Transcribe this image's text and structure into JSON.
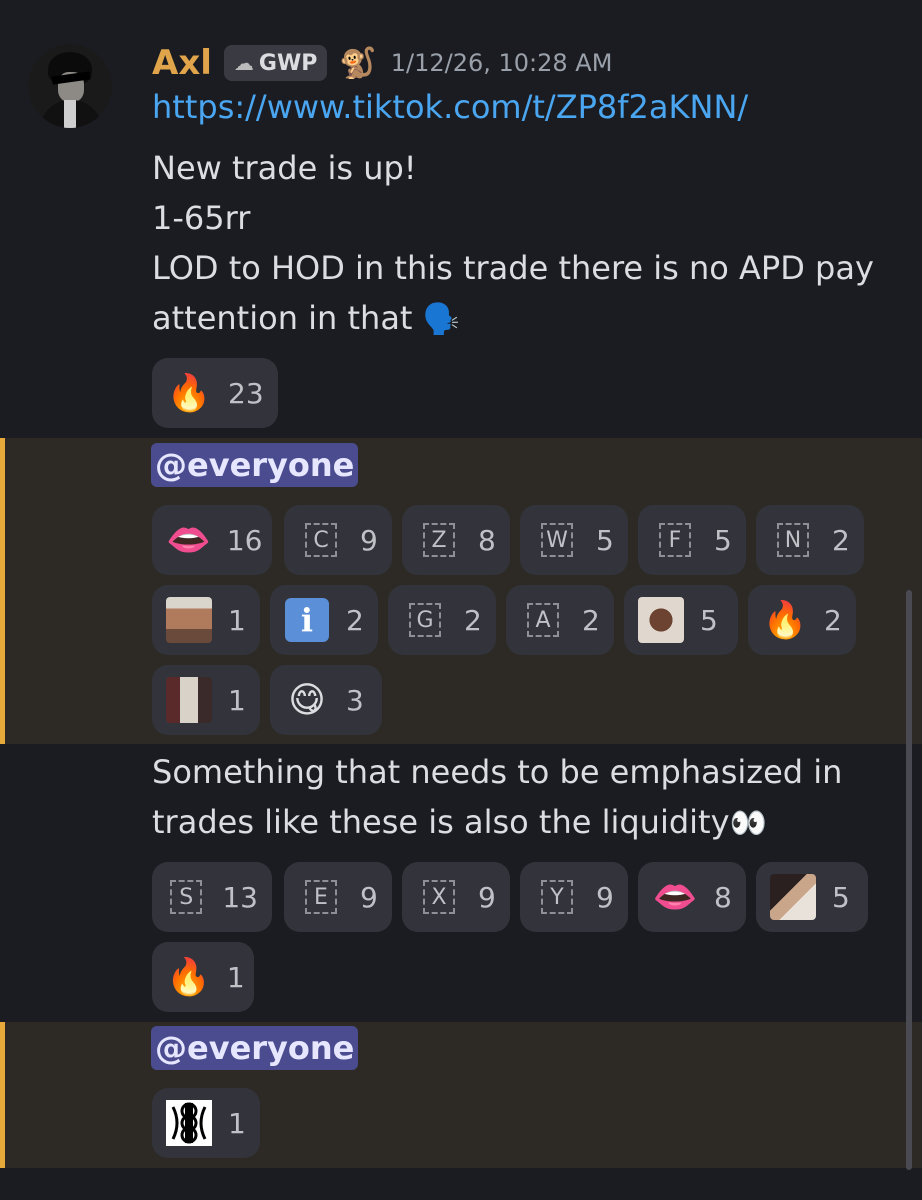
{
  "message": {
    "author": "Axl",
    "tag": "GWP",
    "time": "1/12/26, 10:28 AM",
    "link": "https://www.tiktok.com/t/ZP8f2aKNN/",
    "lines": [
      "New trade is up!",
      "1-65rr",
      "LOD to HOD in this trade there is no APD pay",
      "attention in  that"
    ]
  },
  "reactions1": [
    {
      "emoji": "🔥",
      "count": "23"
    }
  ],
  "mention1": "@everyone",
  "reactions2": [
    {
      "emoji": "👄",
      "count": "16"
    },
    {
      "key": "C",
      "count": "9"
    },
    {
      "key": "Z",
      "count": "8"
    },
    {
      "key": "W",
      "count": "5"
    },
    {
      "key": "F",
      "count": "5"
    },
    {
      "key": "N",
      "count": "2"
    },
    {
      "image": "man-photo",
      "count": "1"
    },
    {
      "emoji": "ℹ️",
      "count": "2"
    },
    {
      "key": "G",
      "count": "2"
    },
    {
      "key": "A",
      "count": "2"
    },
    {
      "image": "shocked-face-photo",
      "count": "5"
    },
    {
      "emoji": "🔥",
      "count": "2"
    },
    {
      "image": "person-photo",
      "count": "1"
    },
    {
      "emoji": "😋",
      "count": "3"
    }
  ],
  "line2": [
    "Something that needs to be emphasized in",
    "trades like these is also the  liquidity"
  ],
  "reactions3": [
    {
      "key": "S",
      "count": "13"
    },
    {
      "key": "E",
      "count": "9"
    },
    {
      "key": "X",
      "count": "9"
    },
    {
      "key": "Y",
      "count": "9"
    },
    {
      "emoji": "👄",
      "count": "8"
    },
    {
      "image": "cards-photo",
      "count": "5"
    },
    {
      "emoji": "🔥",
      "count": "1"
    }
  ],
  "mention2": "@everyone",
  "reactions4": [
    {
      "image": "symbol-icon",
      "count": "1"
    }
  ]
}
